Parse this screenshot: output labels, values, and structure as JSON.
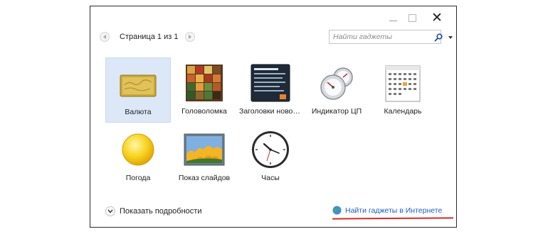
{
  "window": {
    "controls": {
      "minimize_icon": "minimize-icon",
      "maximize_icon": "maximize-icon",
      "close_symbol": "✕"
    }
  },
  "toolbar": {
    "page_label": "Страница 1 из 1",
    "search_placeholder": "Найти гаджеты"
  },
  "gadgets": [
    {
      "name": "Валюта",
      "icon": "currency-icon",
      "selected": true
    },
    {
      "name": "Головоломка",
      "icon": "puzzle-icon",
      "selected": false
    },
    {
      "name": "Заголовки новостей",
      "icon": "news-headlines-icon",
      "selected": false
    },
    {
      "name": "Индикатор ЦП",
      "icon": "cpu-meter-icon",
      "selected": false
    },
    {
      "name": "Календарь",
      "icon": "calendar-icon",
      "selected": false
    },
    {
      "name": "Погода",
      "icon": "weather-icon",
      "selected": false
    },
    {
      "name": "Показ слайдов",
      "icon": "slideshow-icon",
      "selected": false
    },
    {
      "name": "Часы",
      "icon": "clock-icon",
      "selected": false
    }
  ],
  "footer": {
    "details_label": "Показать подробности",
    "online_link": "Найти гаджеты в Интернете"
  },
  "colors": {
    "selection": "#dce8f7",
    "link": "#1f5fbf",
    "annotation_underline": "#d42a2a"
  }
}
